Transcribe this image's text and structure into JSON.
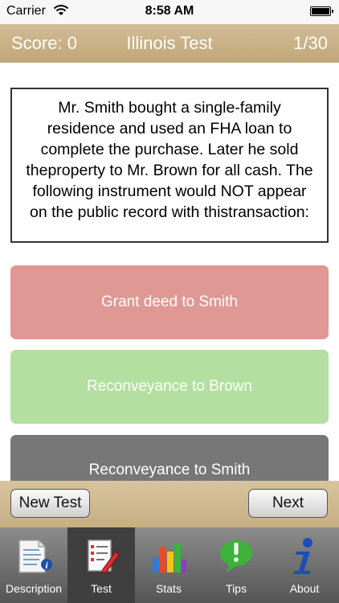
{
  "status_bar": {
    "carrier": "Carrier",
    "time": "8:58 AM"
  },
  "header": {
    "score": "Score: 0",
    "title": "Illinois Test",
    "progress": "1/30"
  },
  "question": "Mr. Smith bought a single-family residence and used an FHA loan to complete the purchase. Later he sold theproperty to Mr. Brown for all cash. The following instrument would NOT appear on the public record with thistransaction:",
  "answers": [
    {
      "label": "Grant deed to Smith",
      "color": "#e09894"
    },
    {
      "label": "Reconveyance to Brown",
      "color": "#b3e0a0"
    },
    {
      "label": "Reconveyance to Smith",
      "color": "#777777"
    }
  ],
  "controls": {
    "new_test": "New Test",
    "next": "Next"
  },
  "tabs": [
    {
      "label": "Description",
      "icon": "description-icon"
    },
    {
      "label": "Test",
      "icon": "test-icon",
      "active": true
    },
    {
      "label": "Stats",
      "icon": "stats-icon"
    },
    {
      "label": "Tips",
      "icon": "tips-icon"
    },
    {
      "label": "About",
      "icon": "about-icon"
    }
  ]
}
